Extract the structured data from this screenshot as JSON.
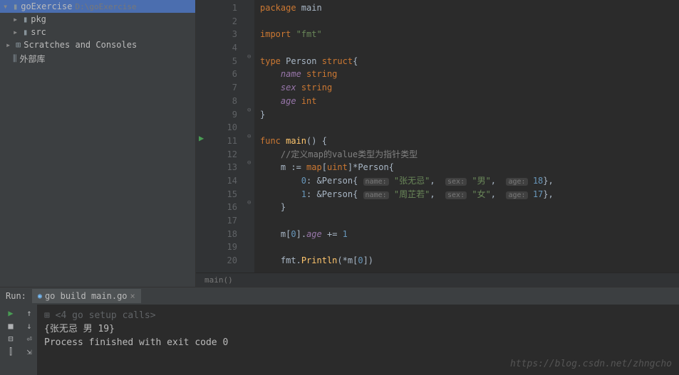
{
  "sidebar": {
    "project_name": "goExercise",
    "project_path": "D:\\goExercise",
    "items": [
      {
        "label": "pkg"
      },
      {
        "label": "src"
      },
      {
        "label": "Scratches and Consoles"
      },
      {
        "label": "外部库"
      }
    ]
  },
  "code": {
    "lines": [
      {
        "n": "1",
        "tokens": [
          [
            "kw",
            "package "
          ],
          [
            "ident",
            "main"
          ]
        ]
      },
      {
        "n": "2",
        "tokens": []
      },
      {
        "n": "3",
        "tokens": [
          [
            "kw",
            "import "
          ],
          [
            "str",
            "\"fmt\""
          ]
        ]
      },
      {
        "n": "4",
        "tokens": []
      },
      {
        "n": "5",
        "tokens": [
          [
            "kw",
            "type "
          ],
          [
            "typ",
            "Person "
          ],
          [
            "kw",
            "struct"
          ],
          [
            "op",
            "{"
          ]
        ]
      },
      {
        "n": "6",
        "tokens": [
          [
            "ident",
            "    "
          ],
          [
            "field",
            "name"
          ],
          [
            "ident",
            " "
          ],
          [
            "kw",
            "string"
          ]
        ]
      },
      {
        "n": "7",
        "tokens": [
          [
            "ident",
            "    "
          ],
          [
            "field",
            "sex"
          ],
          [
            "ident",
            " "
          ],
          [
            "kw",
            "string"
          ]
        ]
      },
      {
        "n": "8",
        "tokens": [
          [
            "ident",
            "    "
          ],
          [
            "field",
            "age"
          ],
          [
            "ident",
            " "
          ],
          [
            "kw",
            "int"
          ]
        ]
      },
      {
        "n": "9",
        "tokens": [
          [
            "op",
            "}"
          ]
        ]
      },
      {
        "n": "10",
        "tokens": []
      },
      {
        "n": "11",
        "tokens": [
          [
            "kw",
            "func "
          ],
          [
            "fn",
            "main"
          ],
          [
            "op",
            "() {"
          ]
        ]
      },
      {
        "n": "12",
        "tokens": [
          [
            "ident",
            "    "
          ],
          [
            "cmt",
            "//定义map的value类型为指针类型"
          ]
        ]
      },
      {
        "n": "13",
        "tokens": [
          [
            "ident",
            "    "
          ],
          [
            "ident",
            "m "
          ],
          [
            "op",
            ":= "
          ],
          [
            "kw",
            "map"
          ],
          [
            "op",
            "["
          ],
          [
            "kw",
            "uint"
          ],
          [
            "op",
            "]*"
          ],
          [
            "typ",
            "Person"
          ],
          [
            "op",
            "{"
          ]
        ]
      },
      {
        "n": "14",
        "tokens": [
          [
            "ident",
            "        "
          ],
          [
            "num",
            "0"
          ],
          [
            "op",
            ": &"
          ],
          [
            "typ",
            "Person"
          ],
          [
            "op",
            "{ "
          ],
          [
            "param-hint",
            "name:"
          ],
          [
            "ident",
            " "
          ],
          [
            "str",
            "\"张无忌\""
          ],
          [
            "op",
            ",  "
          ],
          [
            "param-hint",
            "sex:"
          ],
          [
            "ident",
            " "
          ],
          [
            "str",
            "\"男\""
          ],
          [
            "op",
            ",  "
          ],
          [
            "param-hint",
            "age:"
          ],
          [
            "ident",
            " "
          ],
          [
            "num",
            "18"
          ],
          [
            "op",
            "},"
          ]
        ]
      },
      {
        "n": "15",
        "tokens": [
          [
            "ident",
            "        "
          ],
          [
            "num",
            "1"
          ],
          [
            "op",
            ": &"
          ],
          [
            "typ",
            "Person"
          ],
          [
            "op",
            "{ "
          ],
          [
            "param-hint",
            "name:"
          ],
          [
            "ident",
            " "
          ],
          [
            "str",
            "\"周芷若\""
          ],
          [
            "op",
            ",  "
          ],
          [
            "param-hint",
            "sex:"
          ],
          [
            "ident",
            " "
          ],
          [
            "str",
            "\"女\""
          ],
          [
            "op",
            ",  "
          ],
          [
            "param-hint",
            "age:"
          ],
          [
            "ident",
            " "
          ],
          [
            "num",
            "17"
          ],
          [
            "op",
            "},"
          ]
        ]
      },
      {
        "n": "16",
        "tokens": [
          [
            "ident",
            "    "
          ],
          [
            "op",
            "}"
          ]
        ]
      },
      {
        "n": "17",
        "tokens": []
      },
      {
        "n": "18",
        "tokens": [
          [
            "ident",
            "    "
          ],
          [
            "ident",
            "m"
          ],
          [
            "op",
            "["
          ],
          [
            "num",
            "0"
          ],
          [
            "op",
            "]."
          ],
          [
            "field",
            "age"
          ],
          [
            "ident",
            " "
          ],
          [
            "op",
            "+= "
          ],
          [
            "num",
            "1"
          ]
        ]
      },
      {
        "n": "19",
        "tokens": []
      },
      {
        "n": "20",
        "tokens": [
          [
            "ident",
            "    "
          ],
          [
            "ident",
            "fmt"
          ],
          [
            "op",
            "."
          ],
          [
            "fn",
            "Println"
          ],
          [
            "op",
            "(*"
          ],
          [
            "ident",
            "m"
          ],
          [
            "op",
            "["
          ],
          [
            "num",
            "0"
          ],
          [
            "op",
            "])"
          ]
        ]
      }
    ],
    "run_marker_line": 11,
    "breadcrumb": "main()"
  },
  "run": {
    "label": "Run:",
    "tab_label": "go build main.go",
    "setup": "<4 go setup calls>",
    "output1": "{张无忌 男 19}",
    "output2": "Process finished with exit code 0"
  },
  "watermark": "https://blog.csdn.net/zhngcho"
}
